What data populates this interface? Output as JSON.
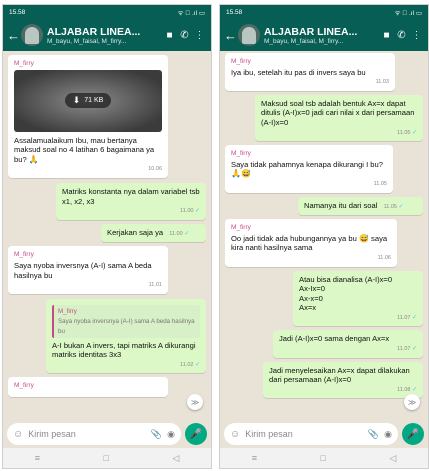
{
  "status": {
    "left_time": "15.58",
    "right_time": "15.58",
    "indicators": "ᯤ ᪲ .ıl ▭"
  },
  "chat": {
    "title": "ALJABAR LINEA...",
    "subtitle_left": "M_bayu, M_faisal, M_firry...",
    "subtitle_right": "M_bayu, M_faisal, M_firry..."
  },
  "icons": {
    "back": "←",
    "video": "■",
    "phone": "✆",
    "menu": "⋮",
    "emoji": "☺",
    "attach": "📎",
    "camera": "◉",
    "mic": "🎤",
    "download": "⬇",
    "scroll_down": "≫",
    "nav_menu": "≡",
    "nav_home": "□",
    "nav_back": "◁"
  },
  "left_messages": {
    "m1": {
      "sender": "M_firry",
      "file_size": "71 KB",
      "text": "Assalamualaikum Ibu, mau bertanya maksud soal no 4 latihan 6 bagaimana ya bu?",
      "emoji": "🙏",
      "time": "10.06"
    },
    "m2": {
      "text": "Matriks konstanta nya dalam variabel tsb x1, x2, x3",
      "time": "11.00",
      "tick": "✓"
    },
    "m3": {
      "text": "Kerjakan saja ya",
      "time": "11.00",
      "tick": "✓"
    },
    "m4": {
      "sender": "M_firry",
      "text": "Saya nyoba inversnya (A-I) sama A beda hasilnya bu",
      "time": "11.01"
    },
    "m5": {
      "quote_sender": "M_firry",
      "quote_text": "Saya nyoba inversnya (A-I) sama A beda hasilnya bu",
      "text": "A-I bukan A invers, tapi matriks A dikurangi matriks identitas 3x3",
      "time": "11.02",
      "tick": "✓"
    },
    "m6": {
      "sender": "M_firry"
    }
  },
  "right_messages": {
    "r1": {
      "sender": "M_firry",
      "text": "Iya ibu, setelah itu pas di invers saya bu",
      "time": "11.03"
    },
    "r2": {
      "text": "Maksud soal tsb adalah bentuk Ax=x dapat ditulis (A-I)x=0 jadi cari nilai x dari persamaan (A-I)x=0",
      "time": "11.05",
      "tick": "✓"
    },
    "r3": {
      "sender": "M_firry",
      "text": "Saya tidak pahamnya kenapa dikurangi I bu?",
      "emoji": "🙏😅",
      "time": "11.05"
    },
    "r4": {
      "text": "Namanya itu dari soal",
      "time": "11.05",
      "tick": "✓"
    },
    "r5": {
      "sender": "M_firry",
      "text_a": "Oo jadi tidak ada hubungannya ya bu",
      "emoji": "😅",
      "text_b": "saya kira nanti hasilnya sama",
      "time": "11.06"
    },
    "r6": {
      "line1": "Atau bisa dianalisa (A-I)x=0",
      "line2": "Ax-Ix=0",
      "line3": "Ax-x=0",
      "line4": "Ax=x",
      "time": "11.07",
      "tick": "✓"
    },
    "r7": {
      "text": "Jadi (A-I)x=0 sama dengan Ax=x",
      "time": "11.07",
      "tick": "✓"
    },
    "r8": {
      "text": "Jadi menyelesaikan Ax=x dapat dilakukan dari persamaan (A-I)x=0",
      "time": "11.08",
      "tick": "✓"
    }
  },
  "composer": {
    "placeholder": "Kirim pesan"
  }
}
